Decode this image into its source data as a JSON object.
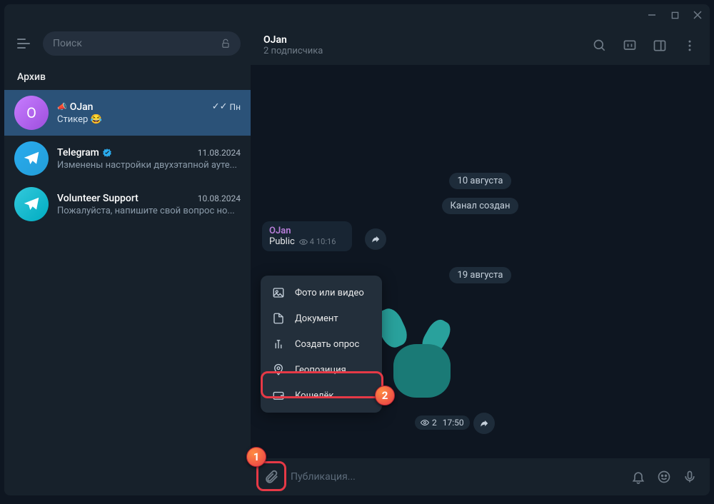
{
  "window_controls": {
    "min": "—",
    "max": "☐",
    "close": "✕"
  },
  "sidebar": {
    "search_placeholder": "Поиск",
    "archive": "Архив",
    "chats": [
      {
        "name": "OJan",
        "preview": "Стикер 😂",
        "time": "Пн",
        "avatar_letter": "O",
        "megaphone": "📢"
      },
      {
        "name": "Telegram",
        "preview": "Изменены настройки двухэтапной ауте...",
        "time": "11.08.2024"
      },
      {
        "name": "Volunteer Support",
        "preview": "Пожалуйста, напишите свой вопрос но...",
        "time": "10.08.2024"
      }
    ]
  },
  "header": {
    "title": "OJan",
    "subtitle": "2 подписчика"
  },
  "messages": {
    "date1": "10 августа",
    "system1": "Канал создан",
    "msg1": {
      "author": "OJan",
      "text": "Public",
      "views": "4",
      "time": "10:16"
    },
    "date2": "19 августа",
    "sticker_views": "2",
    "sticker_time": "17:50"
  },
  "attach_menu": {
    "photo": "Фото или видео",
    "document": "Документ",
    "poll": "Создать опрос",
    "geo": "Геопозиция",
    "wallet": "Кошелёк"
  },
  "input": {
    "placeholder": "Публикация..."
  },
  "markers": {
    "one": "1",
    "two": "2"
  }
}
